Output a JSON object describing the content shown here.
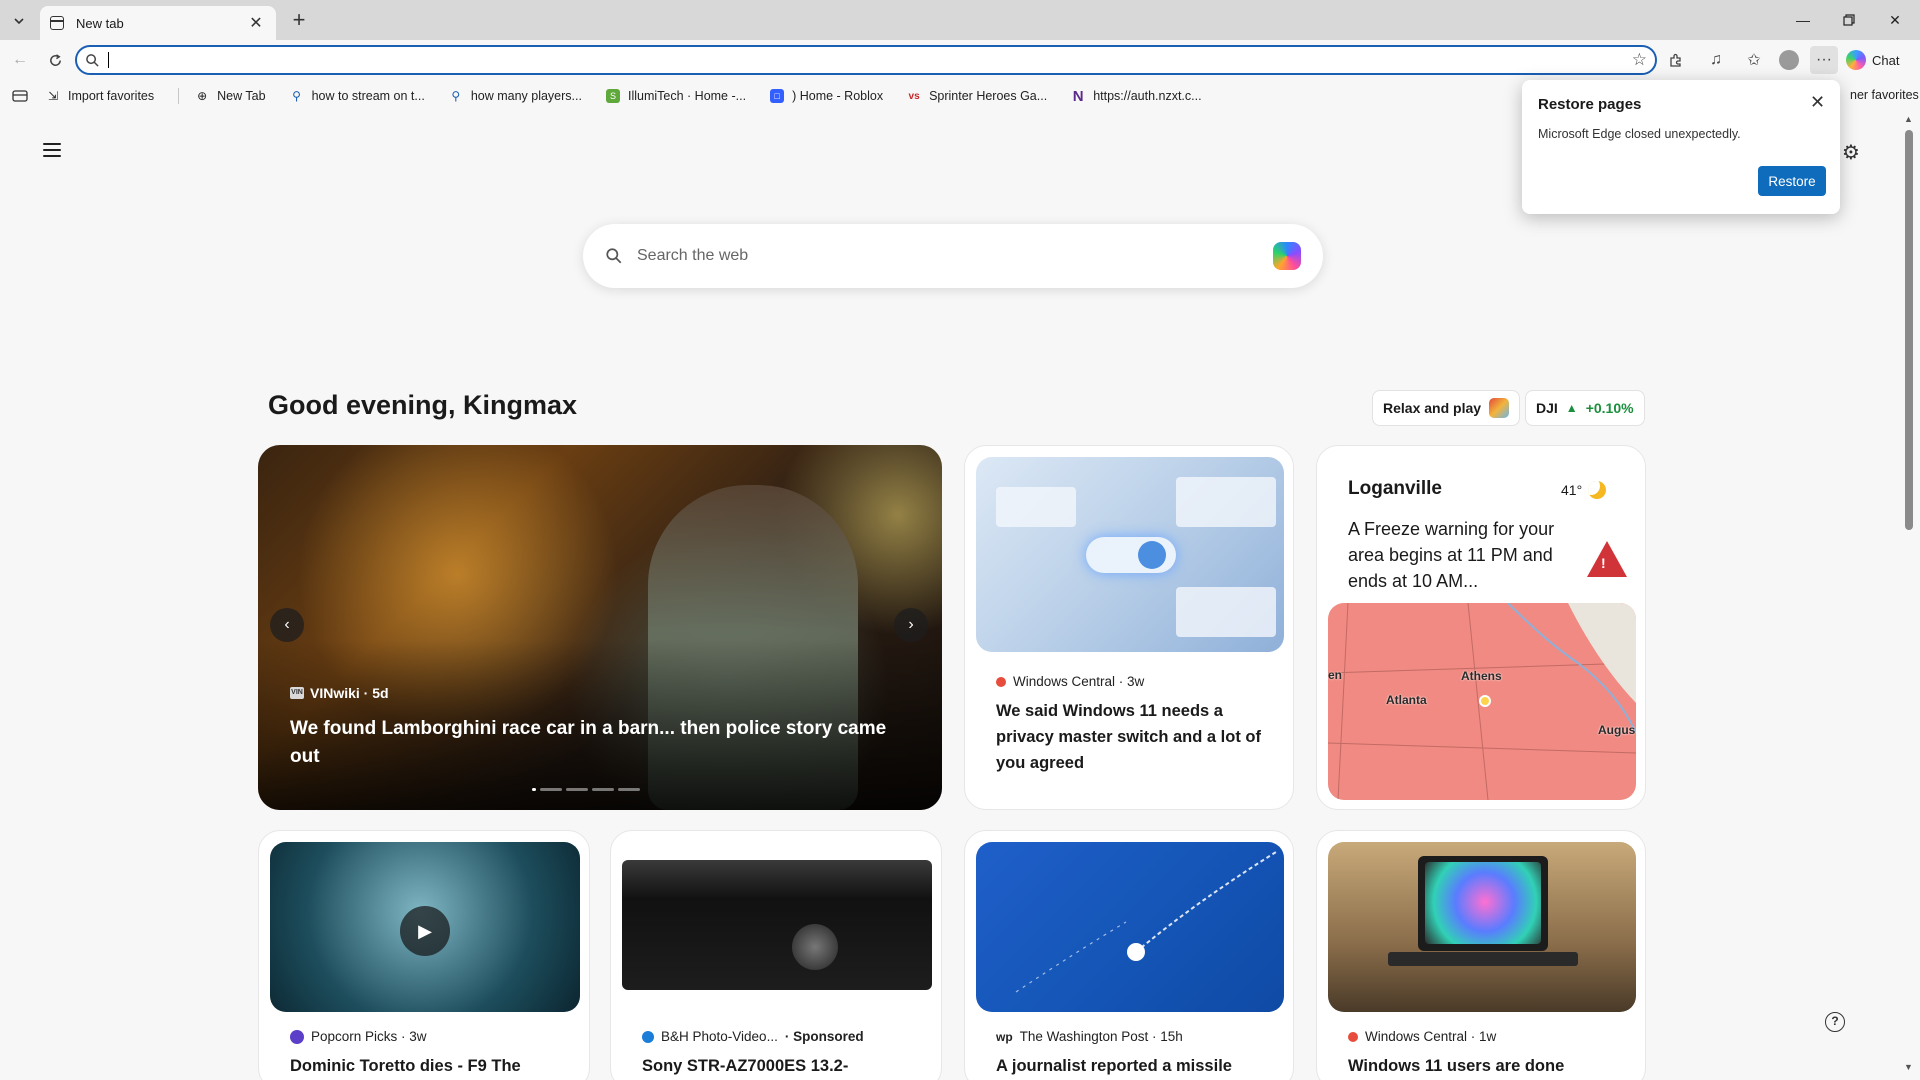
{
  "browser": {
    "tab_title": "New tab",
    "address_value": "",
    "chat_label": "Chat"
  },
  "favorites": {
    "items": [
      {
        "label": "Import favorites",
        "icon": "import-icon"
      },
      {
        "label": "New Tab",
        "icon": "globe-icon"
      },
      {
        "label": "how to stream on t...",
        "icon": "search-icon"
      },
      {
        "label": "how many players...",
        "icon": "search-icon"
      },
      {
        "label": "IllumiTech · Home -...",
        "icon": "shopify-icon"
      },
      {
        "label": ") Home - Roblox",
        "icon": "roblox-icon"
      },
      {
        "label": "Sprinter Heroes Ga...",
        "icon": "vs-icon"
      },
      {
        "label": "https://auth.nzxt.c...",
        "icon": "n-icon"
      }
    ],
    "other_favorites": "ner favorites"
  },
  "newtab": {
    "search_placeholder": "Search the web",
    "greeting": "Good evening, Kingmax",
    "pill_relax": "Relax and play",
    "pill_stock_name": "DJI",
    "pill_stock_change": "+0.10%"
  },
  "hero": {
    "source": "VINwiki · 5d",
    "source_badge": "VIN",
    "title": "We found Lamborghini race car in a barn... then police story came out"
  },
  "cards": {
    "privacy": {
      "source": "Windows Central · 3w",
      "title": "We said Windows 11 needs a privacy master switch and a lot of you agreed"
    },
    "weather": {
      "city": "Loganville",
      "temp": "41°",
      "alert": "A Freeze warning for your area begins at 11 PM and ends at 10 AM...",
      "map_labels": [
        "Athens",
        "Atlanta",
        "Augus",
        "en"
      ]
    },
    "popcorn": {
      "source": "Popcorn Picks · 3w",
      "title": "Dominic Toretto dies - F9 The"
    },
    "bh": {
      "source": "B&H Photo-Video...",
      "sponsored": "· Sponsored",
      "title": "Sony STR-AZ7000ES 13.2-"
    },
    "wapo": {
      "source": "The Washington Post · 15h",
      "title": "A journalist reported a missile"
    },
    "wincentral": {
      "source": "Windows Central · 1w",
      "title": "Windows 11 users are done"
    }
  },
  "popup": {
    "title": "Restore pages",
    "message": "Microsoft Edge closed unexpectedly.",
    "restore_label": "Restore"
  },
  "colors": {
    "accent": "#0f6cbd",
    "address_border": "#1a5fb4",
    "alert_red": "#d13438",
    "stock_up": "#1a8f3c"
  }
}
